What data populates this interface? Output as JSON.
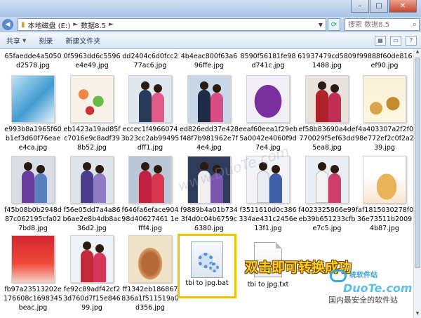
{
  "window": {
    "min_symbol": "–",
    "max_symbol": "□",
    "close_symbol": "✕"
  },
  "address": {
    "segments": [
      "本地磁盘 (E:)",
      "数据8.5"
    ],
    "separator": "►",
    "search_placeholder": "搜索 数据8.5"
  },
  "toolbar": {
    "items": [
      "共享",
      "刻录",
      "新建文件夹"
    ],
    "share_caret": "▼"
  },
  "files": {
    "row0": [
      "65faedde4a5050d2578.jpg",
      "0f5963dd6c5596e4e49.jpg",
      "dd2404c6d0fcc277ac6.jpg",
      "4b4eac800f63a696ffe.jpg",
      "8590f56181fe98d741c.jpg",
      "61937479cd58091488.jpg",
      "f99888f60de816ef90.jpg"
    ],
    "row1": [
      "e993b8a1965f60b1ef3d60f76eaee4ca.jpg",
      "eb1423a19ad85fc7016e9c8adf398b52.jpg",
      "eccec1f49660743b23cc2ab99495dff1.jpg",
      "ed826edd37e428f48f7b981962e7f4e4.jpg",
      "eeaf60eea1f29eb5a0042e4060f9d7e4.jpg",
      "ef58b83690a4de770029f5ef63dd5ea8.jpg",
      "f4a403307a2f2f098e772ef2c0f2a239.jpg"
    ],
    "row2": [
      "f45b08b0b2948d87c062195cfa027bd8.jpg",
      "f56e05dd7a4a86b6ae2e8b4db8ac36d2.jpg",
      "f646fa6eface90498d40627461 1efff4.jpg",
      "f9889b4a01b7343f4d0c04b6759c6380.jpg",
      "f3511610d0c386334ae431c2456e13f1.jpg",
      "f4023325866e99eb39b651233cfbe7c5.jpg",
      "faf1815030278f036e73511b20094b87.jpg"
    ],
    "row3": [
      "fb97a23513202e176608c1698345beac.jpg",
      "fe92c89adf42cf23d760d7f15e84699.jpg",
      "ff1342eb186867836a1f511519a0d356.jpg",
      "tbi to jpg.bat",
      "tbi to jpg.txt"
    ]
  },
  "annotation": "双击即可转换成功",
  "watermark": {
    "site": "统软件站",
    "domain": "DuoTe.com",
    "slogan": "国内最安全的软件站",
    "center": "www.DuoTe.com"
  }
}
